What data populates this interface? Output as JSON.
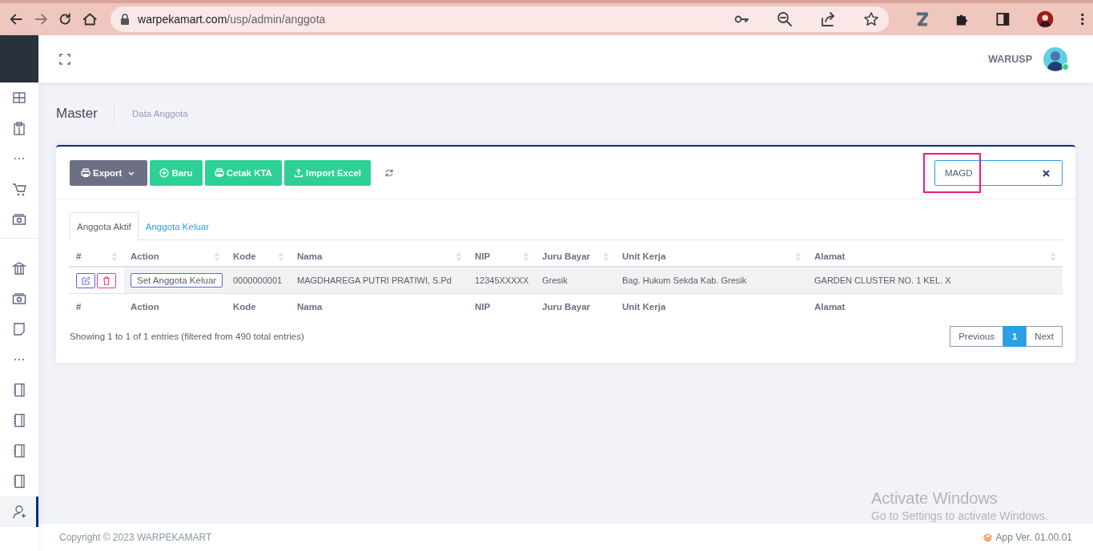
{
  "browser": {
    "url_host": "warpekamart.com",
    "url_path": "/usp/admin/anggota",
    "forward_disabled": true
  },
  "sidebar": {
    "groups": [
      {
        "items": [
          {
            "kind": "link",
            "selected": false
          },
          {
            "kind": "link",
            "selected": false
          },
          {
            "kind": "more",
            "selected": false
          },
          {
            "kind": "link",
            "selected": false
          },
          {
            "kind": "link",
            "selected": false
          }
        ]
      },
      {
        "items": [
          {
            "kind": "link",
            "selected": false
          },
          {
            "kind": "link",
            "selected": false
          },
          {
            "kind": "link",
            "selected": false
          },
          {
            "kind": "more",
            "selected": false
          },
          {
            "kind": "link",
            "selected": false
          },
          {
            "kind": "link",
            "selected": false
          },
          {
            "kind": "link",
            "selected": false
          },
          {
            "kind": "link",
            "selected": false
          },
          {
            "kind": "link",
            "selected": true
          }
        ]
      }
    ]
  },
  "header": {
    "user_name": "WARUSP",
    "online": true
  },
  "page": {
    "title": "Master",
    "breadcrumb": "Data Anggota"
  },
  "toolbar": {
    "buttons": [
      {
        "label": "Export",
        "kind": "dropdown"
      },
      {
        "label": "Baru",
        "kind": "add"
      },
      {
        "label": "Cetak KTA",
        "kind": "print"
      },
      {
        "label": "Import Excel",
        "kind": "upload"
      }
    ]
  },
  "search": {
    "value": "MAGD",
    "highlighted": true
  },
  "tabs": [
    {
      "label": "Anggota Aktif",
      "selected": true
    },
    {
      "label": "Anggota Keluar",
      "selected": false
    }
  ],
  "table": {
    "columns": [
      "#",
      "Action",
      "Kode",
      "Nama",
      "NIP",
      "Juru Bayar",
      "Unit Kerja",
      "Alamat"
    ],
    "rows": [
      {
        "cells": [
          "",
          "Set Anggota Keluar",
          "0000000001",
          "MAGDHAREGA PUTRI PRATIWI, S.Pd",
          "12345XXXXX",
          "Gresik",
          "Bag. Hukum Sekda Kab. Gresik",
          "GARDEN CLUSTER NO. 1 KEL. X"
        ]
      }
    ],
    "footer_columns": [
      "#",
      "Action",
      "Kode",
      "Nama",
      "NIP",
      "Juru Bayar",
      "Unit Kerja",
      "Alamat"
    ]
  },
  "info": "Showing 1 to 1 of 1 entries (filtered from 490 total entries)",
  "pagination": {
    "previous": "Previous",
    "pages": [
      {
        "label": "1",
        "selected": true
      }
    ],
    "next": "Next"
  },
  "footer": {
    "copyright": "Copyright © 2023 WARPEKAMART",
    "version": "App Ver. 01.00.01"
  },
  "os_notice": {
    "title": "Activate Windows",
    "text": "Go to Settings to activate Windows."
  }
}
